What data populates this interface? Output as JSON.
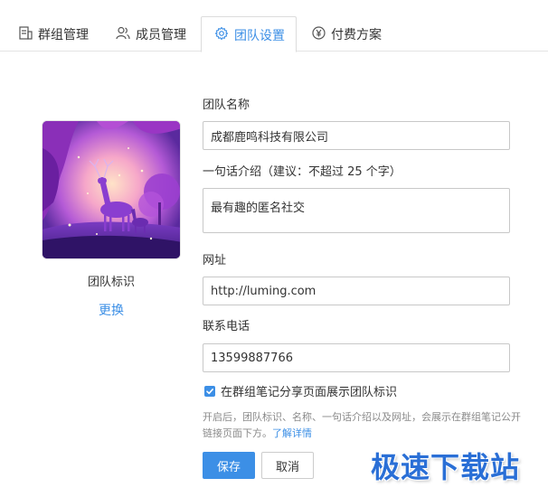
{
  "tabs": [
    {
      "label": "群组管理",
      "icon": "group-doc-icon",
      "active": false
    },
    {
      "label": "成员管理",
      "icon": "members-icon",
      "active": false
    },
    {
      "label": "团队设置",
      "icon": "gear-icon",
      "active": true
    },
    {
      "label": "付费方案",
      "icon": "yen-icon",
      "active": false
    }
  ],
  "team_logo": {
    "caption": "团队标识",
    "change_link": "更换",
    "image_icon": "deer-illustration"
  },
  "form": {
    "name_label": "团队名称",
    "name_value": "成都鹿鸣科技有限公司",
    "intro_label": "一句话介绍（建议：不超过 25 个字）",
    "intro_value": "最有趣的匿名社交",
    "url_label": "网址",
    "url_value": "http://luming.com",
    "phone_label": "联系电话",
    "phone_value": "13599887766",
    "show_logo_checkbox_label": "在群组笔记分享页面展示团队标识",
    "show_logo_checked": true,
    "hint_text": "开启后，团队标识、名称、一句话介绍以及网址，会展示在群组笔记公开链接页面下方。",
    "hint_link": "了解详情"
  },
  "buttons": {
    "save_label": "保存",
    "cancel_label": "取消"
  },
  "watermark": "极速下载站",
  "colors": {
    "accent": "#3c8fe6",
    "text": "#333333",
    "muted": "#8a8a8a",
    "border": "#c8c8c8"
  }
}
